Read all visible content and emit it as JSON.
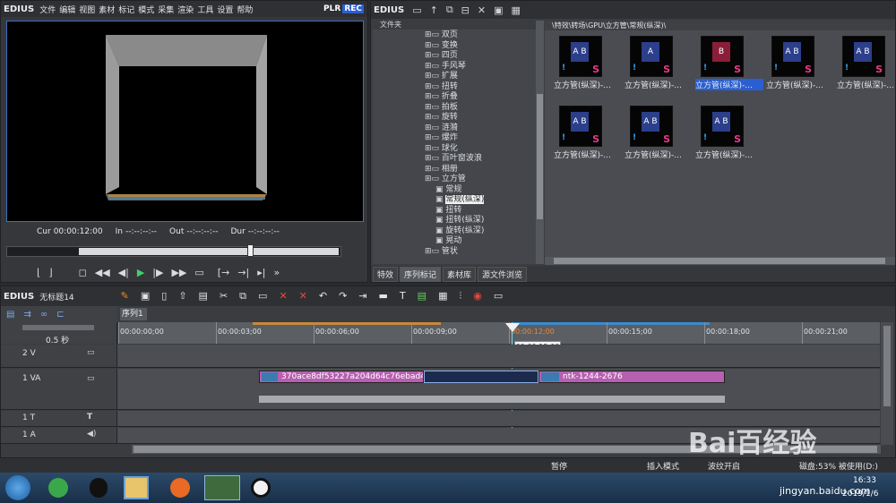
{
  "player": {
    "brand": "EDIUS",
    "menu": [
      "文件",
      "编辑",
      "视图",
      "素材",
      "标记",
      "模式",
      "采集",
      "渲染",
      "工具",
      "设置",
      "帮助"
    ],
    "plr": "PLR",
    "rec": "REC",
    "cur_label": "Cur",
    "cur_value": "00:00:12:00",
    "in_label": "In",
    "in_value": "--:--:--:--",
    "out_label": "Out",
    "out_value": "--:--:--:--",
    "dur_label": "Dur",
    "dur_value": "--:--:--:--"
  },
  "bin": {
    "brand": "EDIUS",
    "folder_header": "文件夹",
    "path": "\\特效\\转场\\GPU\\立方管\\常规(纵深)\\",
    "tree_items": [
      "双页",
      "变换",
      "四页",
      "手风琴",
      "扩展",
      "扭转",
      "折叠",
      "拍板",
      "旋转",
      "涟漪",
      "爆炸",
      "球化",
      "百叶窗波浪",
      "相册",
      "立方管",
      "常规",
      "常规(纵深)",
      "扭转",
      "扭转(纵深)",
      "旋转(纵深)",
      "晃动",
      "管状"
    ],
    "tabs": [
      "特效",
      "序列标记",
      "素材库",
      "源文件浏览"
    ],
    "thumbs": [
      {
        "label": "立方管(纵深)-...",
        "glyph": "A B"
      },
      {
        "label": "立方管(纵深)-...",
        "glyph": "A"
      },
      {
        "label": "立方管(纵深)-...",
        "glyph": "B"
      },
      {
        "label": "立方管(纵深)-...",
        "glyph": "A B"
      },
      {
        "label": "立方管(纵深)-...",
        "glyph": "A B"
      },
      {
        "label": "立方管(纵深)-...",
        "glyph": "A B"
      },
      {
        "label": "立方管(纵深)-...",
        "glyph": "A B"
      },
      {
        "label": "立方管(纵深)-...",
        "glyph": "A B"
      }
    ]
  },
  "timeline": {
    "brand": "EDIUS",
    "project": "无标题14",
    "sequence_tab": "序列1",
    "scale": "0.5 秒",
    "ruler": [
      "00:00:00;00",
      "00:00:03;00",
      "00:00:06;00",
      "00:00:09;00",
      "00:00:12;00",
      "00:00:15;00",
      "00:00:18;00",
      "00:00:21;00"
    ],
    "playhead_tip": "00:00:12:00",
    "tracks": [
      "2 V",
      "1 VA",
      "1 T",
      "1 A"
    ],
    "clip1": "370ace8df53227a204d64c76ebad46...",
    "clip2": "ntk-1244-2676"
  },
  "statusbar": {
    "pause": "暂停",
    "insert_mode": "插入模式",
    "ripple": "波纹开启",
    "disk": "磁盘:53% 被使用(D:)"
  },
  "taskbar": {
    "time": "16:33",
    "date": "2019/1/6"
  },
  "watermark": {
    "text": "Bai百经验",
    "url": "jingyan.baidu.com"
  }
}
